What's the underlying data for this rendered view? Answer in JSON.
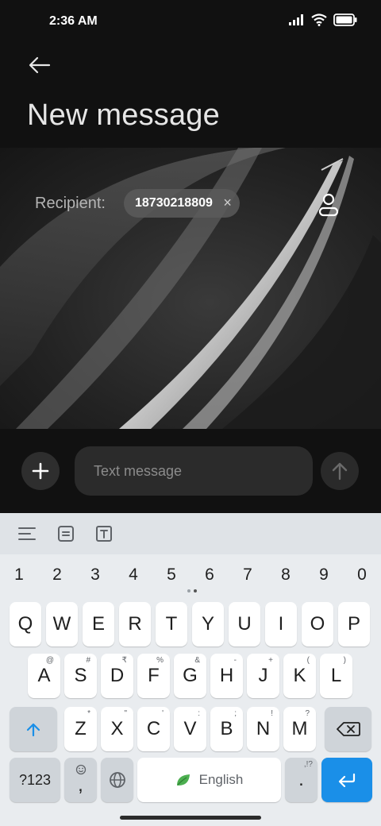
{
  "status_bar": {
    "time": "2:36 AM"
  },
  "header": {
    "title": "New message"
  },
  "recipient": {
    "label": "Recipient:",
    "number": "18730218809",
    "remove_glyph": "×"
  },
  "compose": {
    "placeholder": "Text message"
  },
  "keyboard": {
    "numbers": [
      "1",
      "2",
      "3",
      "4",
      "5",
      "6",
      "7",
      "8",
      "9",
      "0"
    ],
    "row1": [
      {
        "k": "Q",
        "h": ""
      },
      {
        "k": "W",
        "h": ""
      },
      {
        "k": "E",
        "h": ""
      },
      {
        "k": "R",
        "h": ""
      },
      {
        "k": "T",
        "h": ""
      },
      {
        "k": "Y",
        "h": ""
      },
      {
        "k": "U",
        "h": ""
      },
      {
        "k": "I",
        "h": ""
      },
      {
        "k": "O",
        "h": ""
      },
      {
        "k": "P",
        "h": ""
      }
    ],
    "row2": [
      {
        "k": "A",
        "h": "@"
      },
      {
        "k": "S",
        "h": "#"
      },
      {
        "k": "D",
        "h": "₹"
      },
      {
        "k": "F",
        "h": "%"
      },
      {
        "k": "G",
        "h": "&"
      },
      {
        "k": "H",
        "h": "-"
      },
      {
        "k": "J",
        "h": "+"
      },
      {
        "k": "K",
        "h": "("
      },
      {
        "k": "L",
        "h": ")"
      }
    ],
    "row3": [
      {
        "k": "Z",
        "h": "*"
      },
      {
        "k": "X",
        "h": "\""
      },
      {
        "k": "C",
        "h": "'"
      },
      {
        "k": "V",
        "h": ":"
      },
      {
        "k": "B",
        "h": ";"
      },
      {
        "k": "N",
        "h": "!"
      },
      {
        "k": "M",
        "h": "?"
      }
    ],
    "symbols_label": "?123",
    "comma_label": ",",
    "space_label": "English",
    "period_label": ".",
    "period_hint": ",!?"
  },
  "colors": {
    "accent": "#1a8fe8",
    "background": "#111111",
    "keyboard_bg": "#e9ecef"
  }
}
